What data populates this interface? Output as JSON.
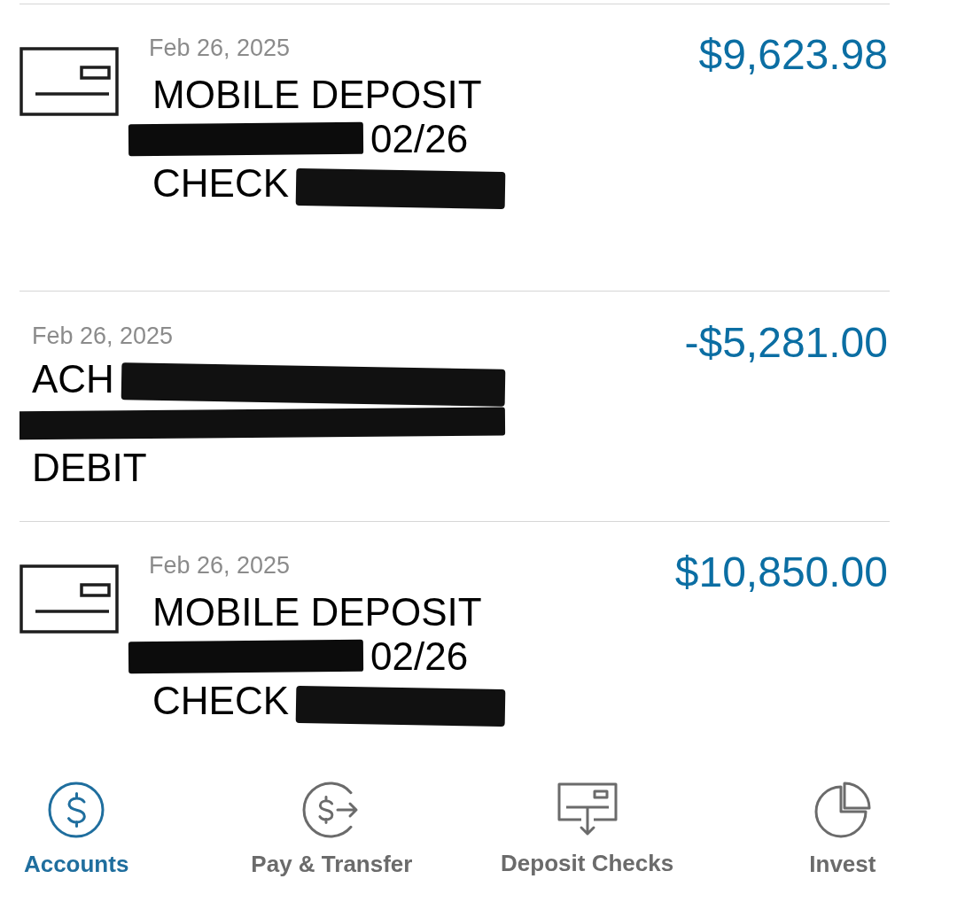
{
  "transactions": [
    {
      "kind": "check",
      "date": "Feb 26, 2025",
      "lines": [
        [
          {
            "kind": "text",
            "text": "MOBILE DEPOSIT"
          }
        ],
        [
          {
            "kind": "redaction"
          },
          {
            "kind": "text",
            "text": "02/26"
          }
        ],
        [
          {
            "kind": "text",
            "text": "CHECK"
          },
          {
            "kind": "redaction"
          }
        ]
      ],
      "amount": "$9,623.98"
    },
    {
      "kind": "ach",
      "date": "Feb 26, 2025",
      "lines": [
        [
          {
            "kind": "text",
            "text": "ACH"
          },
          {
            "kind": "redaction"
          }
        ],
        [
          {
            "kind": "redaction"
          }
        ],
        [
          {
            "kind": "text",
            "text": "DEBIT"
          }
        ]
      ],
      "amount": "-$5,281.00"
    },
    {
      "kind": "check",
      "date": "Feb 26, 2025",
      "lines": [
        [
          {
            "kind": "text",
            "text": "MOBILE DEPOSIT"
          }
        ],
        [
          {
            "kind": "redaction"
          },
          {
            "kind": "text",
            "text": "02/26"
          }
        ],
        [
          {
            "kind": "text",
            "text": "CHECK"
          },
          {
            "kind": "redaction"
          }
        ]
      ],
      "amount": "$10,850.00"
    }
  ],
  "tab_bar": {
    "tabs": [
      {
        "kind": "accounts",
        "label": "Accounts",
        "selected": true
      },
      {
        "kind": "transfer",
        "label": "Pay & Transfer",
        "selected": false
      },
      {
        "kind": "deposit",
        "label": "Deposit Checks",
        "selected": false
      },
      {
        "kind": "invest",
        "label": "Invest",
        "selected": false
      }
    ]
  }
}
